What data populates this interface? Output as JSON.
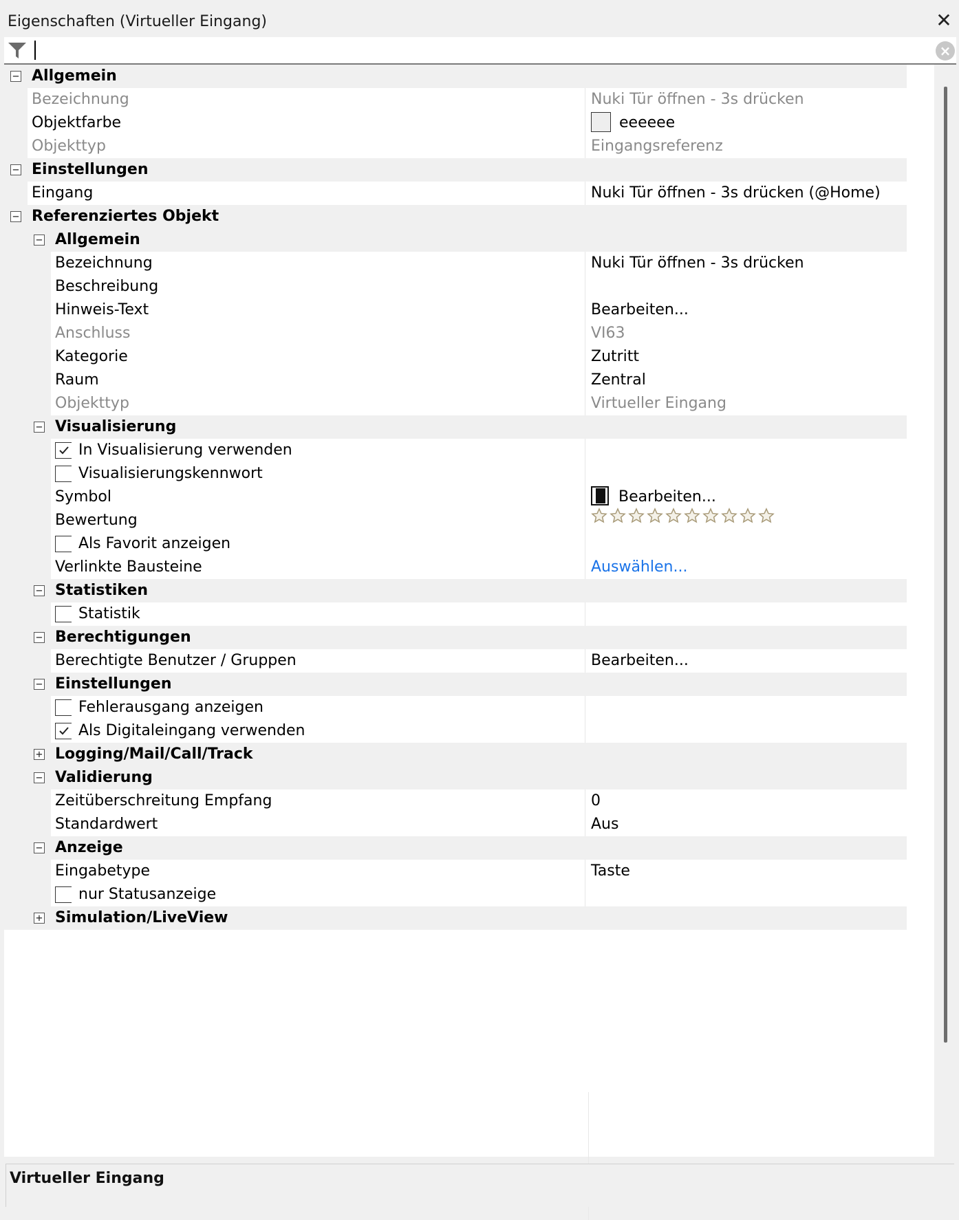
{
  "panel": {
    "title": "Eigenschaften (Virtueller Eingang)",
    "close_glyph": "✕",
    "filter_icon": "filter-icon",
    "filter_value": "",
    "clear_glyph": "×"
  },
  "grid": {
    "rows": [
      {
        "kind": "category",
        "level": 0,
        "expanded": true,
        "label": "Allgemein"
      },
      {
        "kind": "prop",
        "level": 0,
        "label": "Bezeichnung",
        "value": "Nuki Tür öffnen - 3s drücken",
        "readonly": true
      },
      {
        "kind": "prop",
        "level": 0,
        "label": "Objektfarbe",
        "value": "eeeeee",
        "swatch": "#eeeeee"
      },
      {
        "kind": "prop",
        "level": 0,
        "label": "Objekttyp",
        "value": "Eingangsreferenz",
        "readonly": true
      },
      {
        "kind": "category",
        "level": 0,
        "expanded": true,
        "label": "Einstellungen"
      },
      {
        "kind": "prop",
        "level": 0,
        "label": "Eingang",
        "value": "Nuki Tür öffnen - 3s drücken (@Home)"
      },
      {
        "kind": "category",
        "level": 0,
        "expanded": true,
        "label": "Referenziertes Objekt"
      },
      {
        "kind": "category",
        "level": 1,
        "expanded": true,
        "label": "Allgemein"
      },
      {
        "kind": "prop",
        "level": 1,
        "label": "Bezeichnung",
        "value": "Nuki Tür öffnen - 3s drücken"
      },
      {
        "kind": "prop",
        "level": 1,
        "label": "Beschreibung",
        "value": ""
      },
      {
        "kind": "prop",
        "level": 1,
        "label": "Hinweis-Text",
        "value": "Bearbeiten..."
      },
      {
        "kind": "prop",
        "level": 1,
        "label": "Anschluss",
        "value": "VI63",
        "readonly": true
      },
      {
        "kind": "prop",
        "level": 1,
        "label": "Kategorie",
        "value": "Zutritt"
      },
      {
        "kind": "prop",
        "level": 1,
        "label": "Raum",
        "value": "Zentral"
      },
      {
        "kind": "prop",
        "level": 1,
        "label": "Objekttyp",
        "value": "Virtueller Eingang",
        "readonly": true
      },
      {
        "kind": "category",
        "level": 1,
        "expanded": true,
        "label": "Visualisierung"
      },
      {
        "kind": "check",
        "level": 1,
        "label": "In Visualisierung verwenden",
        "checked": true
      },
      {
        "kind": "check",
        "level": 1,
        "label": "Visualisierungskennwort",
        "checked": false
      },
      {
        "kind": "prop",
        "level": 1,
        "label": "Symbol",
        "value": "Bearbeiten...",
        "icon": "door-symbol-icon"
      },
      {
        "kind": "rating",
        "level": 1,
        "label": "Bewertung",
        "rating": 0,
        "max": 10
      },
      {
        "kind": "check",
        "level": 1,
        "label": "Als Favorit anzeigen",
        "checked": false
      },
      {
        "kind": "prop",
        "level": 1,
        "label": "Verlinkte Bausteine",
        "value": "Auswählen...",
        "link": true
      },
      {
        "kind": "category",
        "level": 1,
        "expanded": true,
        "label": "Statistiken"
      },
      {
        "kind": "check",
        "level": 1,
        "label": "Statistik",
        "checked": false
      },
      {
        "kind": "category",
        "level": 1,
        "expanded": true,
        "label": "Berechtigungen"
      },
      {
        "kind": "prop",
        "level": 1,
        "label": "Berechtigte Benutzer / Gruppen",
        "value": "Bearbeiten..."
      },
      {
        "kind": "category",
        "level": 1,
        "expanded": true,
        "label": "Einstellungen"
      },
      {
        "kind": "check",
        "level": 1,
        "label": "Fehlerausgang anzeigen",
        "checked": false
      },
      {
        "kind": "check",
        "level": 1,
        "label": "Als Digitaleingang verwenden",
        "checked": true
      },
      {
        "kind": "category",
        "level": 1,
        "expanded": false,
        "label": "Logging/Mail/Call/Track"
      },
      {
        "kind": "category",
        "level": 1,
        "expanded": true,
        "label": "Validierung"
      },
      {
        "kind": "prop",
        "level": 1,
        "label": "Zeitüberschreitung Empfang",
        "value": "0"
      },
      {
        "kind": "prop",
        "level": 1,
        "label": "Standardwert",
        "value": "Aus"
      },
      {
        "kind": "category",
        "level": 1,
        "expanded": true,
        "label": "Anzeige"
      },
      {
        "kind": "prop",
        "level": 1,
        "label": "Eingabetype",
        "value": "Taste"
      },
      {
        "kind": "check",
        "level": 1,
        "label": "nur Statusanzeige",
        "checked": false
      },
      {
        "kind": "category",
        "level": 1,
        "expanded": false,
        "label": "Simulation/LiveView"
      }
    ]
  },
  "description": {
    "title": "Virtueller Eingang"
  },
  "colors": {
    "link": "#1a73e8",
    "readonly_text": "#8a8a8a",
    "category_bg": "#f0f0f0"
  }
}
